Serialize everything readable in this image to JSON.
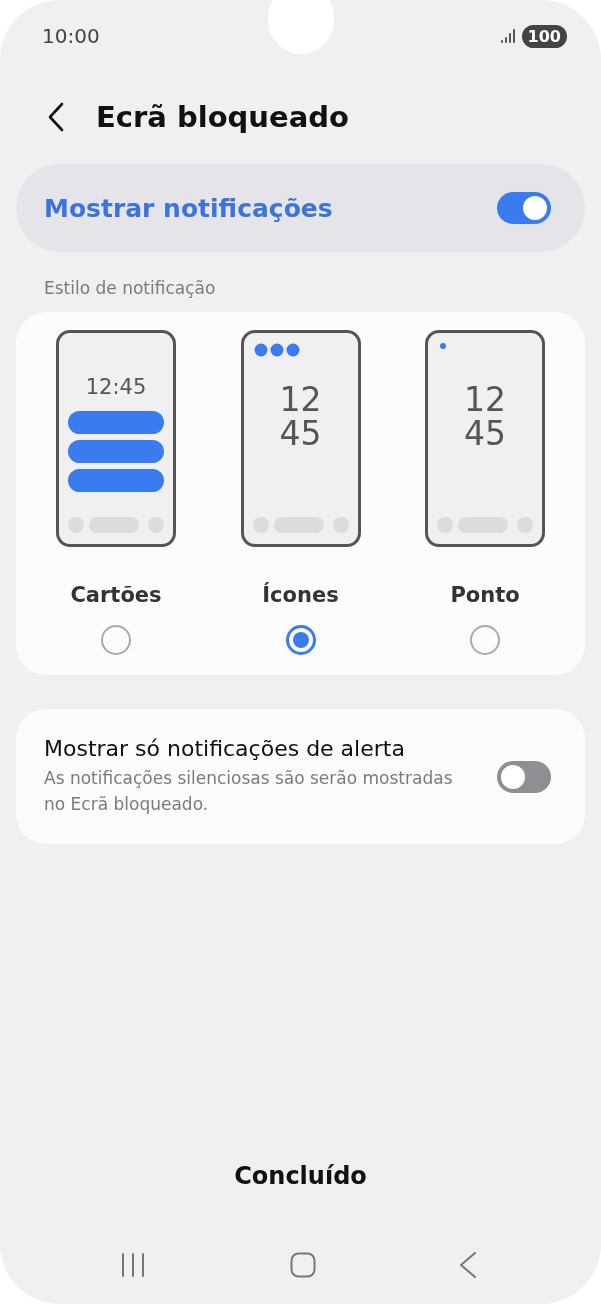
{
  "status_bar": {
    "time": "10:00",
    "battery": "100"
  },
  "header": {
    "title": "Ecrã bloqueado"
  },
  "main_toggle": {
    "label": "Mostrar notificações",
    "on": true
  },
  "section_label": "Estilo de notificação",
  "styles": [
    {
      "kind": "cards",
      "clock": [
        "12:45"
      ],
      "label": "Cartões",
      "selected": false
    },
    {
      "kind": "icons",
      "clock": [
        "12",
        "45"
      ],
      "label": "Ícones",
      "selected": true
    },
    {
      "kind": "dot",
      "clock": [
        "12",
        "45"
      ],
      "label": "Ponto",
      "selected": false
    }
  ],
  "alert_setting": {
    "title": "Mostrar só notificações de alerta",
    "description": "As notificações silenciosas são serão mostradas no Ecrã bloqueado.",
    "on": false
  },
  "done_button": "Concluído"
}
